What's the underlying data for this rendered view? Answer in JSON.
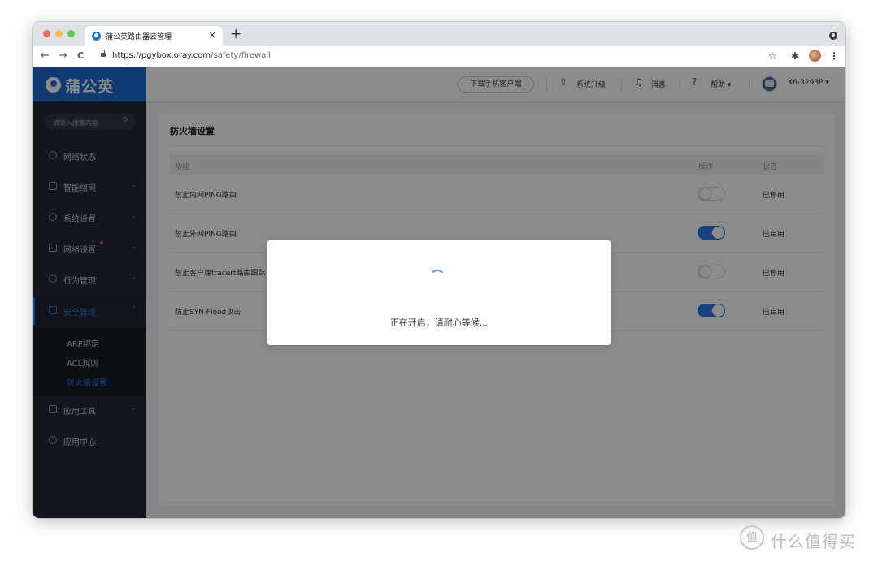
{
  "browser": {
    "tab_title": "蒲公英路由器云管理",
    "tab_close": "×",
    "new_tab": "+",
    "url_host": "https://pgybox.oray.com",
    "url_path": "/safety/firewall",
    "back": "←",
    "forward": "→",
    "reload": "C",
    "star": "☆",
    "extensions": "✱",
    "menu": "⋮"
  },
  "sidebar": {
    "brand": "蒲公英",
    "search_placeholder": "请输入搜索内容",
    "items": [
      {
        "label": "网络状态",
        "icon": "network-status-icon",
        "has_arrow": false
      },
      {
        "label": "智能组网",
        "icon": "smart-network-icon",
        "has_arrow": true
      },
      {
        "label": "系统设置",
        "icon": "system-settings-icon",
        "has_arrow": true
      },
      {
        "label": "网络设置",
        "icon": "network-settings-icon",
        "has_arrow": true
      },
      {
        "label": "行为管理",
        "icon": "behavior-icon",
        "has_arrow": true
      },
      {
        "label": "安全管理",
        "icon": "security-icon",
        "has_arrow": true
      },
      {
        "label": "应用工具",
        "icon": "tools-icon",
        "has_arrow": true
      },
      {
        "label": "应用中心",
        "icon": "app-center-icon",
        "has_arrow": false
      }
    ],
    "sub_items": [
      "ARP绑定",
      "ACL规则",
      "防火墙设置"
    ],
    "arrow": "⌄"
  },
  "header": {
    "download_client": "下载手机客户端",
    "upgrade": "系统升级",
    "messages": "消息",
    "help": "帮助 ▾",
    "device": "X6-3293P ▾"
  },
  "panel": {
    "title": "防火墙设置",
    "columns": {
      "function": "功能",
      "action": "操作",
      "status": "状态"
    },
    "rows": [
      {
        "function": "禁止内网PING路由",
        "enabled": false,
        "status": "已停用"
      },
      {
        "function": "禁止外网PING路由",
        "enabled": true,
        "status": "已启用"
      },
      {
        "function": "禁止客户端tracert路由跟踪",
        "enabled": false,
        "status": "已停用"
      },
      {
        "function": "防止SYN Flood攻击",
        "enabled": true,
        "status": "已启用"
      }
    ]
  },
  "modal": {
    "message": "正在开启，请耐心等候..."
  },
  "watermark": {
    "logo_glyph": "值",
    "text": "什么值得买"
  },
  "colors": {
    "accent": "#2b7de9",
    "sidebar_bg": "#232a35",
    "brand_bg": "#1e6ccf"
  }
}
